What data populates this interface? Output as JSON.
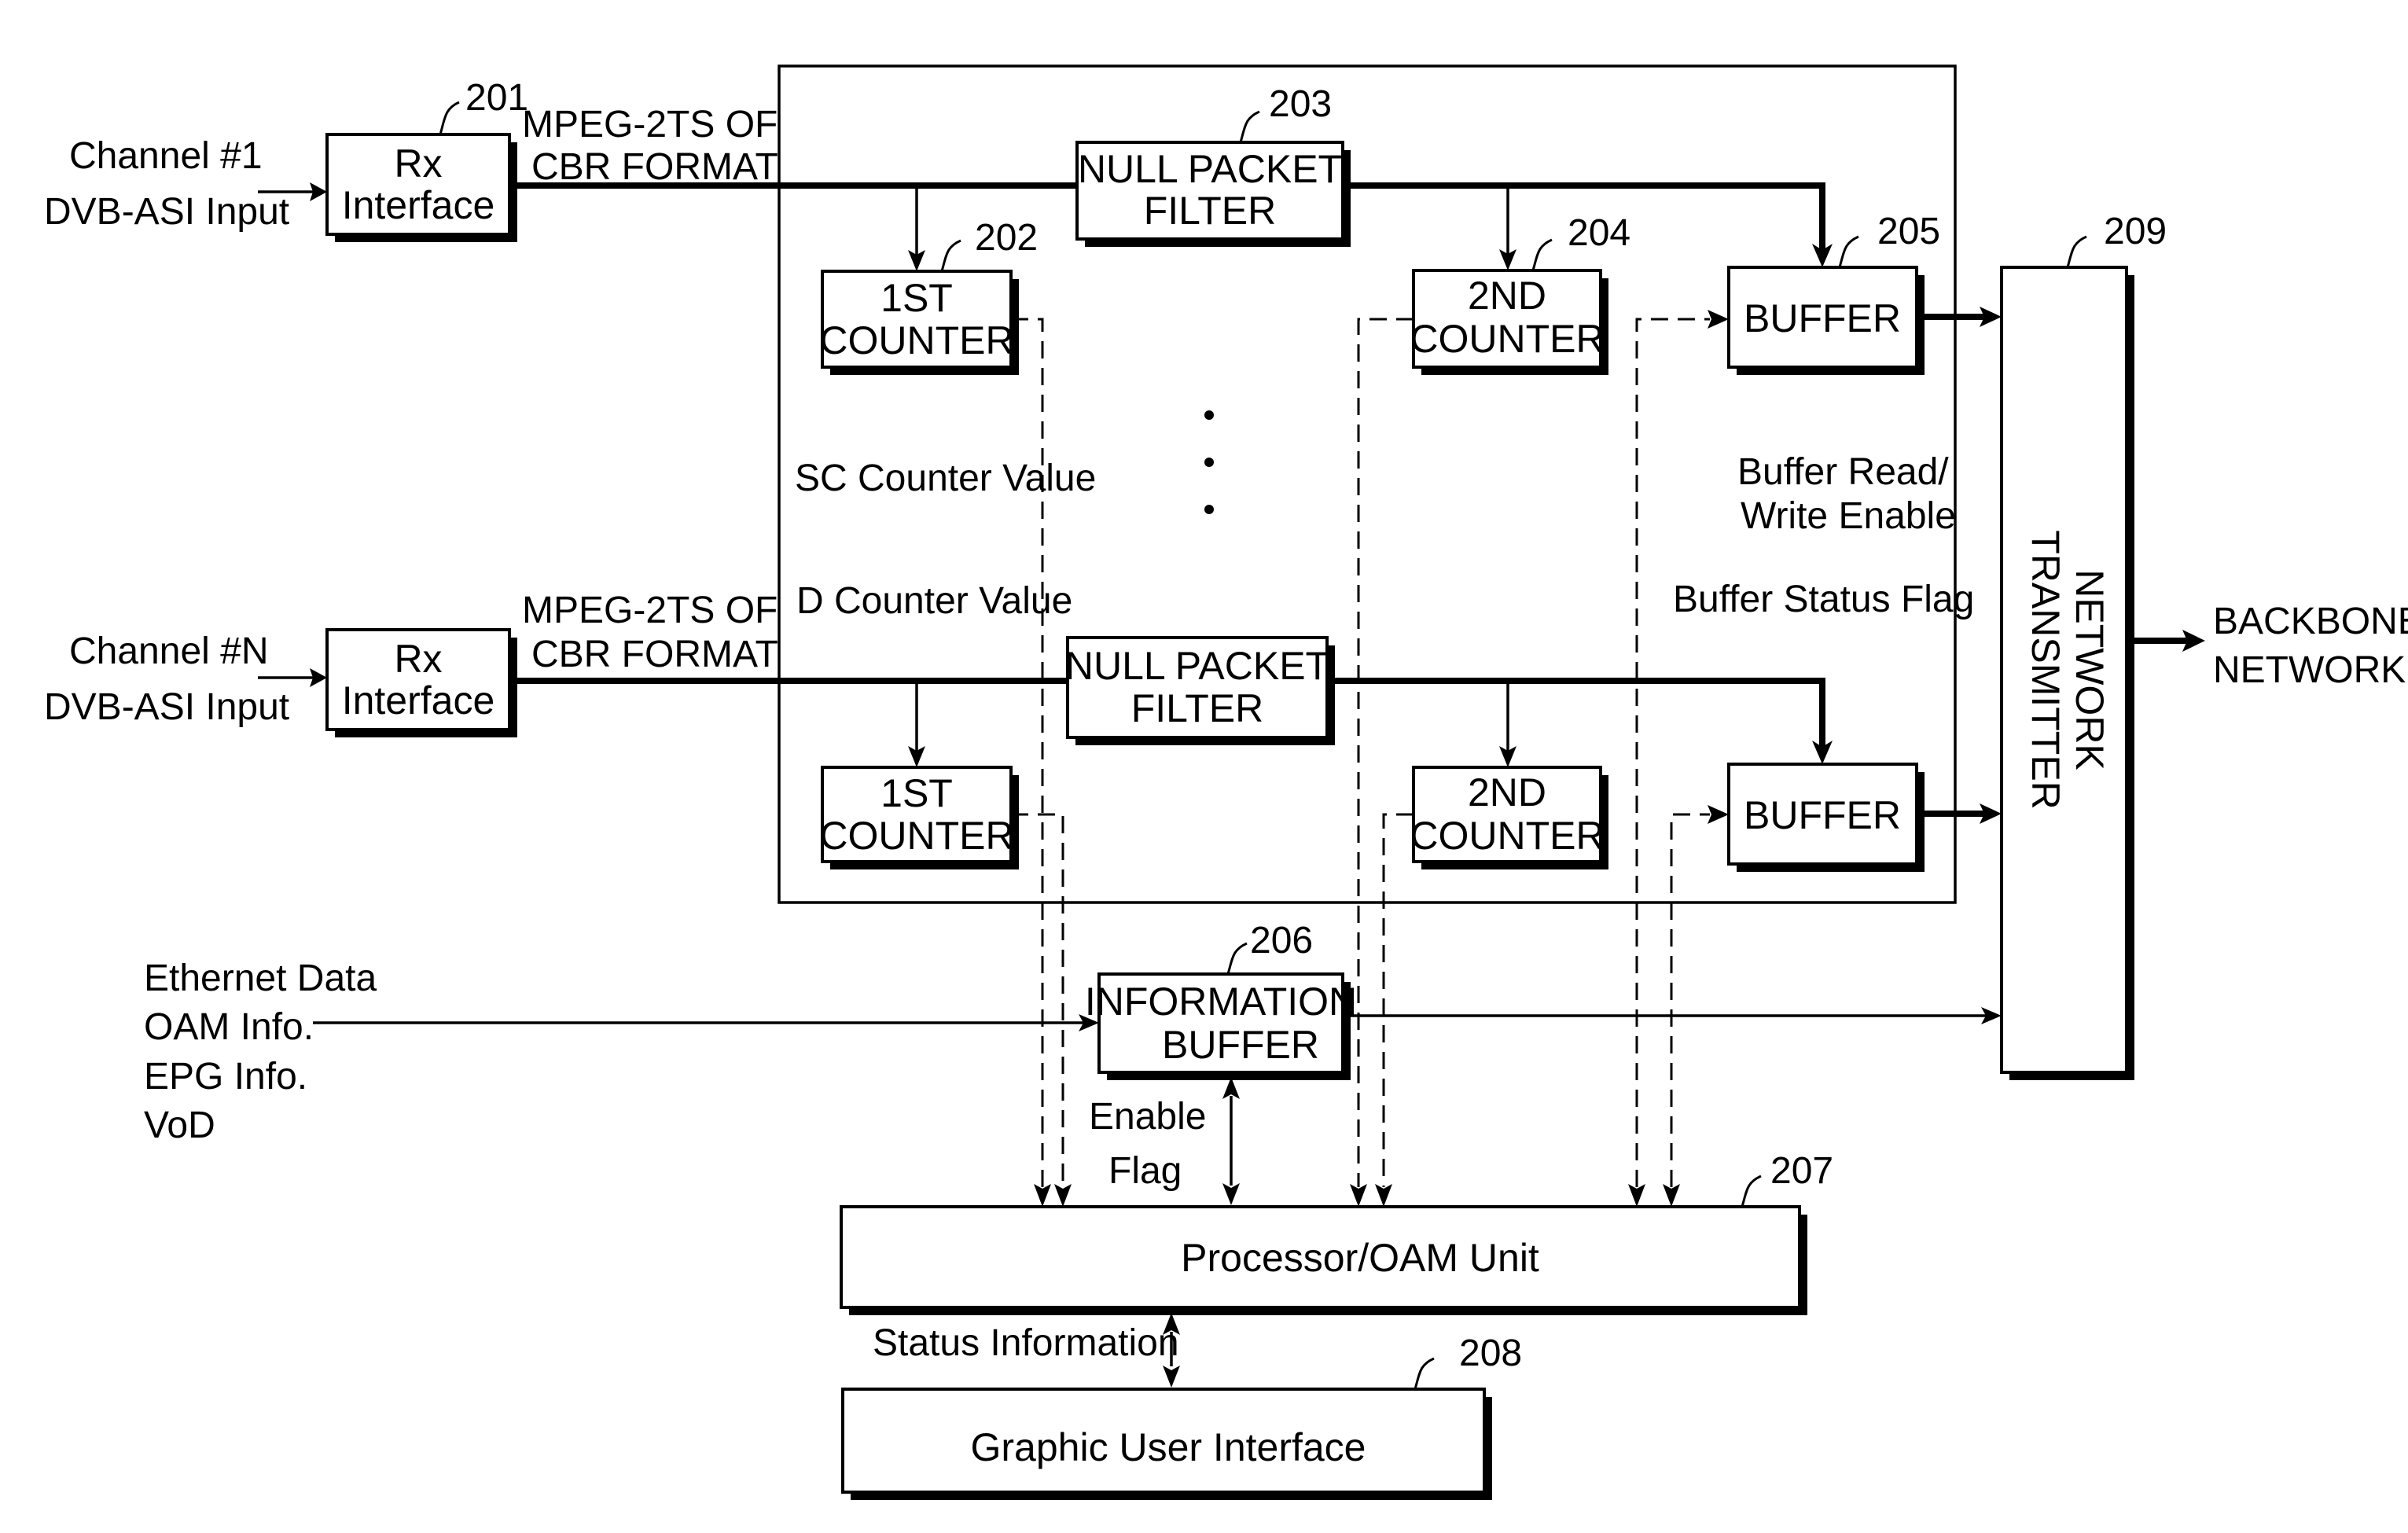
{
  "inputs": {
    "channel_1": [
      "Channel #1",
      "DVB-ASI Input"
    ],
    "channel_n": [
      "Channel #N",
      "DVB-ASI Input"
    ],
    "aux": [
      "Ethernet Data",
      "OAM Info.",
      "EPG Info.",
      "VoD"
    ]
  },
  "blocks": {
    "rx_1": {
      "lines": [
        "Rx",
        "Interface"
      ],
      "ref": "201"
    },
    "rx_n": {
      "lines": [
        "Rx",
        "Interface"
      ]
    },
    "null_filter_1": {
      "lines": [
        "NULL PACKET",
        "FILTER"
      ],
      "ref": "203"
    },
    "null_filter_n": {
      "lines": [
        "NULL PACKET",
        "FILTER"
      ]
    },
    "counter1_1": {
      "lines": [
        "1ST",
        "COUNTER"
      ],
      "ref": "202"
    },
    "counter1_n": {
      "lines": [
        "1ST",
        "COUNTER"
      ]
    },
    "counter2_1": {
      "lines": [
        "2ND",
        "COUNTER"
      ],
      "ref": "204"
    },
    "counter2_n": {
      "lines": [
        "2ND",
        "COUNTER"
      ]
    },
    "buffer_1": {
      "lines": [
        "BUFFER"
      ],
      "ref": "205"
    },
    "buffer_n": {
      "lines": [
        "BUFFER"
      ]
    },
    "network_tx": {
      "lines": [
        "NETWORK",
        "TRANSMITTER"
      ],
      "ref": "209"
    },
    "info_buffer": {
      "lines": [
        "INFORMATION",
        "BUFFER"
      ],
      "ref": "206"
    },
    "processor": {
      "lines": [
        "Processor/OAM Unit"
      ],
      "ref": "207"
    },
    "gui": {
      "lines": [
        "Graphic User Interface"
      ],
      "ref": "208"
    }
  },
  "labels": {
    "stream_1": [
      "MPEG-2TS OF",
      "CBR FORMAT"
    ],
    "stream_n": [
      "MPEG-2TS OF",
      "CBR FORMAT"
    ],
    "sc_counter": "SC Counter Value",
    "d_counter": "D Counter Value",
    "buffer_rw": [
      "Buffer Read/",
      "Write Enable"
    ],
    "buffer_status": "Buffer Status Flag",
    "enable_flag": [
      "Enable",
      "Flag"
    ],
    "status_info": "Status Information",
    "output": [
      "BACKBONE",
      "NETWORK"
    ],
    "ellipsis": "• • •"
  }
}
